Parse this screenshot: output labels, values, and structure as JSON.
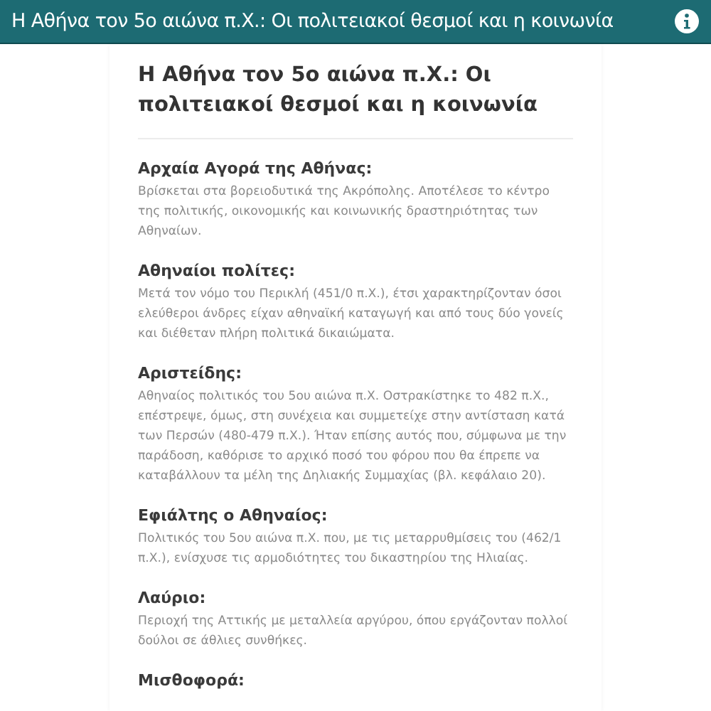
{
  "header": {
    "title": "Η Αθήνα τον 5ο αιώνα π.Χ.: Οι πολιτειακοί θεσμοί και η κοινωνία"
  },
  "article": {
    "title": "Η Αθήνα τον 5ο αιώνα π.Χ.: Οι πολιτειακοί θεσμοί και η κοινωνία",
    "entries": [
      {
        "term": "Αρχαία Αγορά της Αθήνας:",
        "definition": "Βρίσκεται στα βορειοδυτικά της Ακρόπολης. Αποτέλεσε το κέντρο της πολιτικής, οικονομικής και κοινωνικής δραστηριότητας των Αθηναίων."
      },
      {
        "term": "Αθηναίοι πολίτες:",
        "definition": "Μετά τον νόμο του Περικλή (451/0 π.Χ.), έτσι χαρακτηρίζονταν όσοι ελεύθεροι άνδρες είχαν αθηναϊκή καταγωγή και από τους δύο γονείς και διέθεταν πλήρη πολιτικά δικαιώματα."
      },
      {
        "term": "Αριστείδης:",
        "definition": "Αθηναίος πολιτικός του 5ου αιώνα π.Χ. Οστρακίστηκε το 482 π.Χ., επέστρεψε, όμως, στη συνέχεια και συμμετείχε στην αντίσταση κατά των Περσών (480-479 π.Χ.). Ήταν επίσης αυτός που, σύμφωνα με την παράδοση, καθόρισε το αρχικό ποσό του φόρου που θα έπρεπε να καταβάλλουν τα μέλη της Δηλιακής Συμμαχίας (βλ. κεφάλαιο 20)."
      },
      {
        "term": "Εφιάλτης ο Αθηναίος:",
        "definition": "Πολιτικός του 5ου αιώνα π.Χ. που, με τις μεταρρυθμίσεις του (462/1 π.Χ.), ενίσχυσε τις αρμοδιότητες του δικαστηρίου της Ηλιαίας."
      },
      {
        "term": "Λαύριο:",
        "definition": "Περιοχή της Αττικής με μεταλλεία αργύρου, όπου εργάζονταν πολλοί δούλοι σε άθλιες συνθήκες."
      },
      {
        "term": "Μισθοφορά:"
      }
    ]
  }
}
